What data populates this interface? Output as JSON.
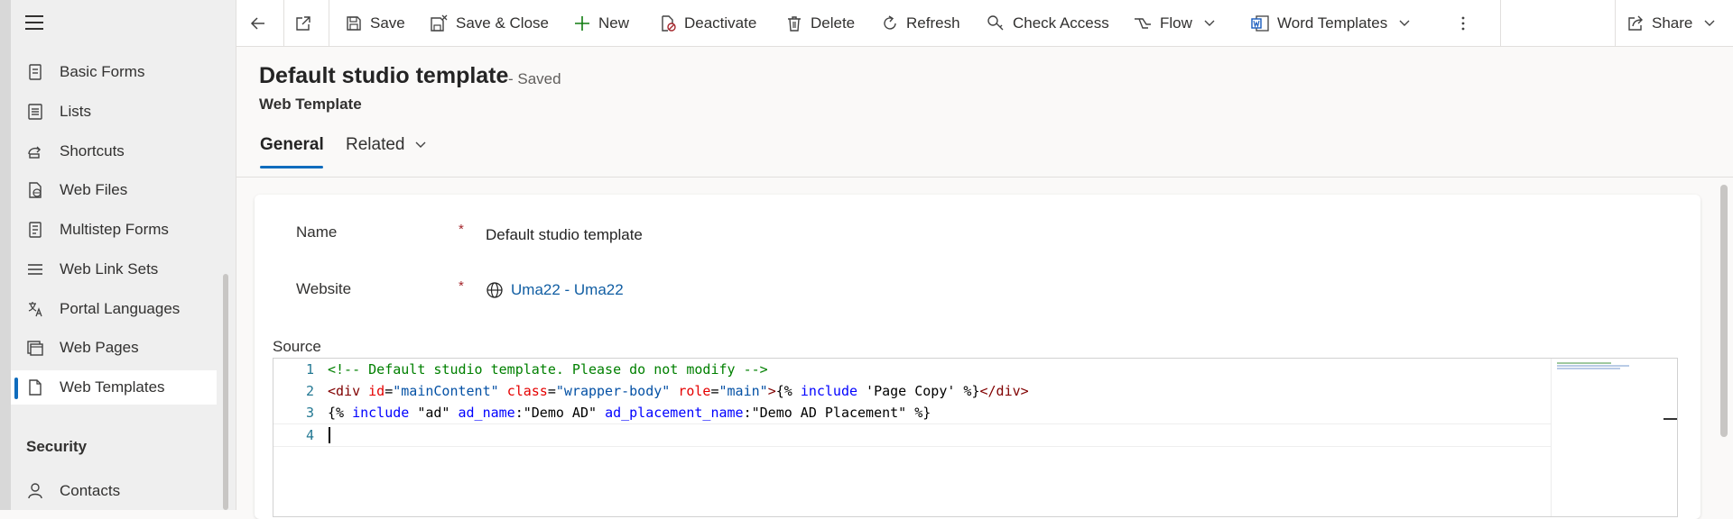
{
  "sidebar": {
    "items": [
      {
        "label": "Basic Forms",
        "icon": "basic-forms-icon"
      },
      {
        "label": "Lists",
        "icon": "lists-icon"
      },
      {
        "label": "Shortcuts",
        "icon": "shortcuts-icon"
      },
      {
        "label": "Web Files",
        "icon": "web-files-icon"
      },
      {
        "label": "Multistep Forms",
        "icon": "multistep-forms-icon"
      },
      {
        "label": "Web Link Sets",
        "icon": "web-link-sets-icon"
      },
      {
        "label": "Portal Languages",
        "icon": "portal-languages-icon"
      },
      {
        "label": "Web Pages",
        "icon": "web-pages-icon"
      },
      {
        "label": "Web Templates",
        "icon": "web-templates-icon",
        "active": true
      }
    ],
    "section_security": "Security",
    "security_items": [
      {
        "label": "Contacts",
        "icon": "contacts-icon"
      }
    ]
  },
  "toolbar": {
    "save": "Save",
    "save_close": "Save & Close",
    "new": "New",
    "deactivate": "Deactivate",
    "delete": "Delete",
    "refresh": "Refresh",
    "check_access": "Check Access",
    "flow": "Flow",
    "word_templates": "Word Templates",
    "share": "Share"
  },
  "record": {
    "title": "Default studio template",
    "status": "- Saved",
    "entity": "Web Template"
  },
  "tabs": {
    "general": "General",
    "related": "Related"
  },
  "form": {
    "name_label": "Name",
    "name_required": "*",
    "name_value": "Default studio template",
    "website_label": "Website",
    "website_required": "*",
    "website_value": "Uma22 - Uma22",
    "source_label": "Source"
  },
  "editor": {
    "lines": [
      {
        "num": "1",
        "tokens": [
          {
            "t": "<!-- Default studio template. Please do not modify -->",
            "c": "comment"
          }
        ]
      },
      {
        "num": "2",
        "tokens": [
          {
            "t": "<div",
            "c": "tag"
          },
          {
            "t": " ",
            "c": "plain"
          },
          {
            "t": "id",
            "c": "attr"
          },
          {
            "t": "=",
            "c": "plain"
          },
          {
            "t": "\"mainContent\"",
            "c": "str"
          },
          {
            "t": " ",
            "c": "plain"
          },
          {
            "t": "class",
            "c": "attr"
          },
          {
            "t": "=",
            "c": "plain"
          },
          {
            "t": "\"wrapper-body\"",
            "c": "str"
          },
          {
            "t": " ",
            "c": "plain"
          },
          {
            "t": "role",
            "c": "attr"
          },
          {
            "t": "=",
            "c": "plain"
          },
          {
            "t": "\"main\"",
            "c": "str"
          },
          {
            "t": ">",
            "c": "tag"
          },
          {
            "t": "{% ",
            "c": "plain"
          },
          {
            "t": "include",
            "c": "kw"
          },
          {
            "t": " 'Page Copy' %}",
            "c": "plain"
          },
          {
            "t": "</div>",
            "c": "tag"
          }
        ]
      },
      {
        "num": "3",
        "tokens": [
          {
            "t": "{% ",
            "c": "plain"
          },
          {
            "t": "include",
            "c": "kw"
          },
          {
            "t": " \"ad\" ",
            "c": "plain"
          },
          {
            "t": "ad_name",
            "c": "kw"
          },
          {
            "t": ":\"Demo AD\" ",
            "c": "plain"
          },
          {
            "t": "ad_placement_name",
            "c": "kw"
          },
          {
            "t": ":\"Demo AD Placement\" %}",
            "c": "plain"
          }
        ]
      },
      {
        "num": "4",
        "tokens": []
      }
    ]
  },
  "colors": {
    "accent": "#0f6cbd",
    "link": "#115ea3",
    "required": "#a4262c"
  }
}
